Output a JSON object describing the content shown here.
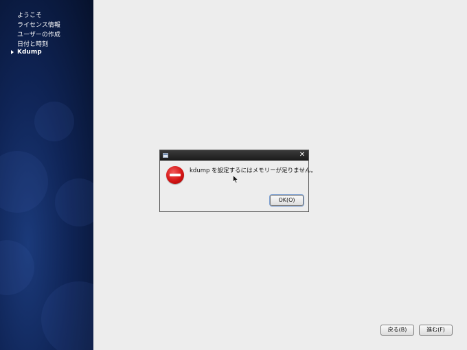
{
  "sidebar": {
    "items": [
      {
        "label": "ようこそ",
        "active": false
      },
      {
        "label": "ライセンス情報",
        "active": false
      },
      {
        "label": "ユーザーの作成",
        "active": false
      },
      {
        "label": "日付と時刻",
        "active": false
      },
      {
        "label": "Kdump",
        "active": true
      }
    ]
  },
  "dialog": {
    "title": "",
    "message": "kdump を設定するにはメモリーが足りません。",
    "ok_label": "OK(O)",
    "close_symbol": "✕",
    "icon": "error-icon"
  },
  "footer": {
    "back_label": "戻る(B)",
    "next_label": "進む(F)"
  },
  "colors": {
    "sidebar_bg": "#0f2456",
    "content_bg": "#ededed",
    "error_red": "#d41515"
  }
}
